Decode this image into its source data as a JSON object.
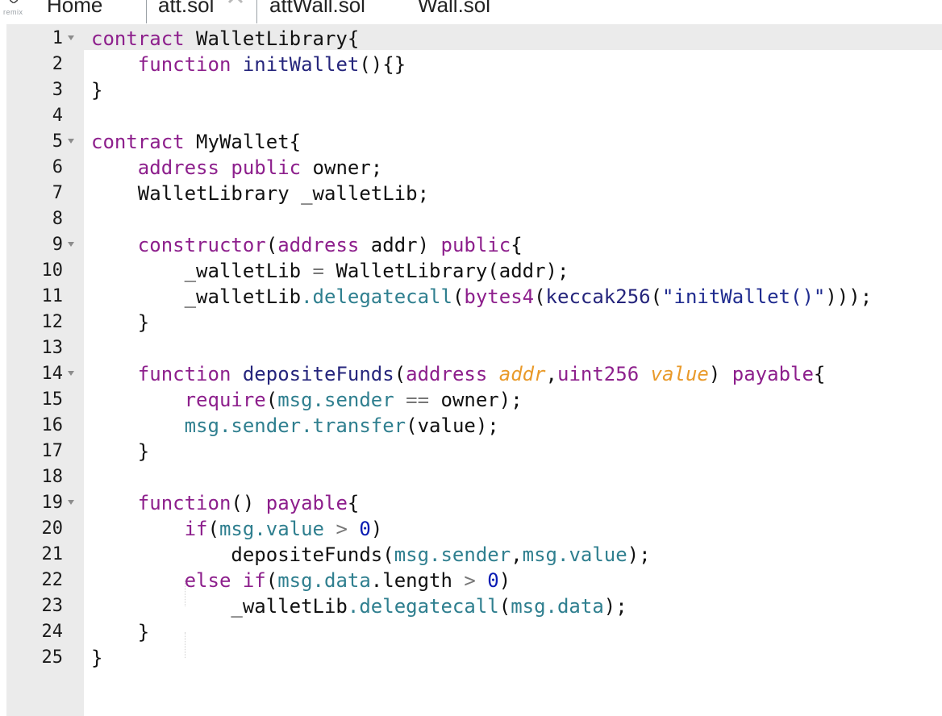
{
  "tabbar": {
    "brand": "remix",
    "tabs": [
      {
        "label": "Home",
        "active": false
      },
      {
        "label": "att.sol",
        "active": true
      },
      {
        "label": "attWall.sol",
        "active": false
      },
      {
        "label": "Wall.sol",
        "active": false
      }
    ]
  },
  "editor": {
    "active_line": 1,
    "lines": [
      {
        "n": "1",
        "fold": true,
        "tokens": [
          [
            "kw",
            "contract"
          ],
          [
            "",
            ""
          ],
          [
            "",
            " WalletLibrary{"
          ]
        ]
      },
      {
        "n": "2",
        "fold": false,
        "tokens": [
          [
            "",
            "    "
          ],
          [
            "kw",
            "function"
          ],
          [
            "",
            " "
          ],
          [
            "fn",
            "initWallet"
          ],
          [
            "",
            "(){}"
          ]
        ]
      },
      {
        "n": "3",
        "fold": false,
        "tokens": [
          [
            "",
            "}"
          ]
        ]
      },
      {
        "n": "4",
        "fold": false,
        "tokens": []
      },
      {
        "n": "5",
        "fold": true,
        "tokens": [
          [
            "kw",
            "contract"
          ],
          [
            "",
            " MyWallet{"
          ]
        ]
      },
      {
        "n": "6",
        "fold": false,
        "tokens": [
          [
            "",
            "    "
          ],
          [
            "kw",
            "address"
          ],
          [
            "",
            " "
          ],
          [
            "kw",
            "public"
          ],
          [
            "",
            " owner;"
          ]
        ]
      },
      {
        "n": "7",
        "fold": false,
        "tokens": [
          [
            "",
            "    WalletLibrary _walletLib;"
          ]
        ]
      },
      {
        "n": "8",
        "fold": false,
        "tokens": []
      },
      {
        "n": "9",
        "fold": true,
        "tokens": [
          [
            "",
            "    "
          ],
          [
            "kw",
            "constructor"
          ],
          [
            "",
            "("
          ],
          [
            "kw",
            "address"
          ],
          [
            "",
            " addr) "
          ],
          [
            "kw",
            "public"
          ],
          [
            "",
            "{"
          ]
        ]
      },
      {
        "n": "10",
        "fold": false,
        "tokens": [
          [
            "",
            "        _walletLib "
          ],
          [
            "op",
            "="
          ],
          [
            "",
            " WalletLibrary(addr);"
          ]
        ]
      },
      {
        "n": "11",
        "fold": false,
        "tokens": [
          [
            "",
            "        _walletLib"
          ],
          [
            "mem",
            ".delegatecall"
          ],
          [
            "",
            "("
          ],
          [
            "kw",
            "bytes4"
          ],
          [
            "",
            "("
          ],
          [
            "fn",
            "keccak256"
          ],
          [
            "",
            "("
          ],
          [
            "str",
            "\"initWallet()\""
          ],
          [
            "",
            ")));"
          ]
        ]
      },
      {
        "n": "12",
        "fold": false,
        "tokens": [
          [
            "",
            "    }"
          ]
        ]
      },
      {
        "n": "13",
        "fold": false,
        "tokens": []
      },
      {
        "n": "14",
        "fold": true,
        "tokens": [
          [
            "",
            "    "
          ],
          [
            "kw",
            "function"
          ],
          [
            "",
            " "
          ],
          [
            "fn",
            "depositeFunds"
          ],
          [
            "",
            "("
          ],
          [
            "kw",
            "address"
          ],
          [
            "",
            " "
          ],
          [
            "par",
            "addr"
          ],
          [
            "",
            ","
          ],
          [
            "kw",
            "uint256"
          ],
          [
            "",
            " "
          ],
          [
            "par",
            "value"
          ],
          [
            "",
            ") "
          ],
          [
            "kw",
            "payable"
          ],
          [
            "",
            "{"
          ]
        ]
      },
      {
        "n": "15",
        "fold": false,
        "tokens": [
          [
            "",
            "        "
          ],
          [
            "kw",
            "require"
          ],
          [
            "",
            "("
          ],
          [
            "mem",
            "msg.sender"
          ],
          [
            "",
            " "
          ],
          [
            "op",
            "=="
          ],
          [
            "",
            " owner);"
          ]
        ]
      },
      {
        "n": "16",
        "fold": false,
        "tokens": [
          [
            "",
            "        "
          ],
          [
            "mem",
            "msg.sender.transfer"
          ],
          [
            "",
            "(value);"
          ]
        ]
      },
      {
        "n": "17",
        "fold": false,
        "tokens": [
          [
            "",
            "    }"
          ]
        ]
      },
      {
        "n": "18",
        "fold": false,
        "tokens": []
      },
      {
        "n": "19",
        "fold": true,
        "tokens": [
          [
            "",
            "    "
          ],
          [
            "kw",
            "function"
          ],
          [
            "",
            "() "
          ],
          [
            "kw",
            "payable"
          ],
          [
            "",
            "{"
          ]
        ]
      },
      {
        "n": "20",
        "fold": false,
        "tokens": [
          [
            "",
            "        "
          ],
          [
            "kw",
            "if"
          ],
          [
            "",
            "("
          ],
          [
            "mem",
            "msg.value"
          ],
          [
            "",
            " "
          ],
          [
            "op",
            ">"
          ],
          [
            "",
            " "
          ],
          [
            "num",
            "0"
          ],
          [
            "",
            ")"
          ]
        ]
      },
      {
        "n": "21",
        "fold": false,
        "tokens": [
          [
            "",
            "            depositeFunds("
          ],
          [
            "mem",
            "msg.sender"
          ],
          [
            "",
            ","
          ],
          [
            "mem",
            "msg.value"
          ],
          [
            "",
            ");"
          ]
        ]
      },
      {
        "n": "22",
        "fold": false,
        "tokens": [
          [
            "",
            "        "
          ],
          [
            "kw",
            "else"
          ],
          [
            "",
            " "
          ],
          [
            "kw",
            "if"
          ],
          [
            "",
            "("
          ],
          [
            "mem",
            "msg.data"
          ],
          [
            "",
            ".length "
          ],
          [
            "op",
            ">"
          ],
          [
            "",
            " "
          ],
          [
            "num",
            "0"
          ],
          [
            "",
            ")"
          ]
        ]
      },
      {
        "n": "23",
        "fold": false,
        "tokens": [
          [
            "",
            "            _walletLib"
          ],
          [
            "mem",
            ".delegatecall"
          ],
          [
            "",
            "("
          ],
          [
            "mem",
            "msg.data"
          ],
          [
            "",
            ");"
          ]
        ]
      },
      {
        "n": "24",
        "fold": false,
        "tokens": [
          [
            "",
            "    }"
          ]
        ]
      },
      {
        "n": "25",
        "fold": false,
        "tokens": [
          [
            "",
            "}"
          ]
        ]
      }
    ]
  }
}
